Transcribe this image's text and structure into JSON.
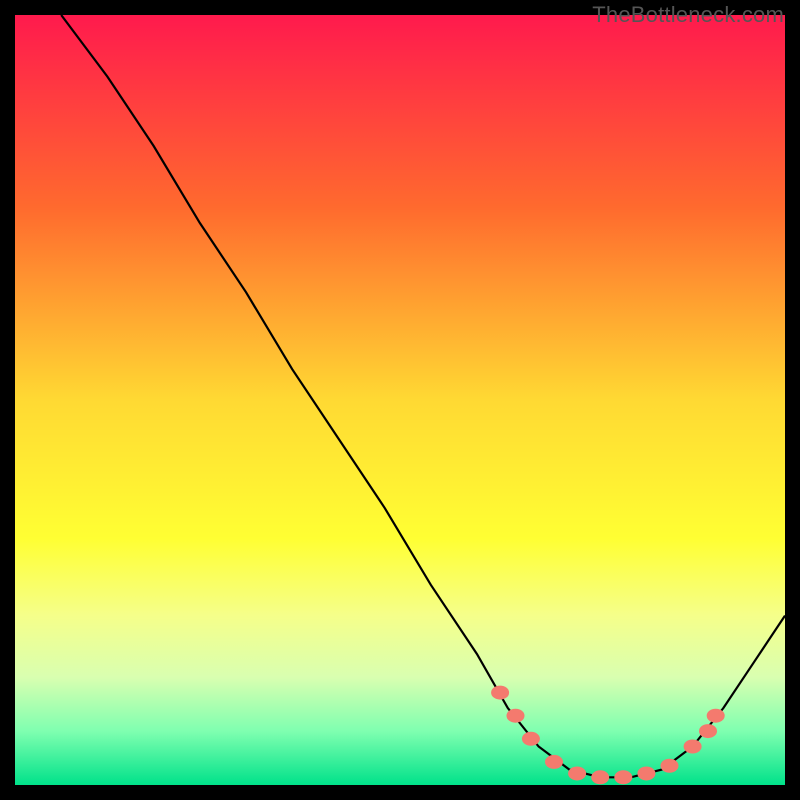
{
  "watermark": "TheBottleneck.com",
  "chart_data": {
    "type": "line",
    "title": "",
    "xlabel": "",
    "ylabel": "",
    "xlim": [
      0,
      100
    ],
    "ylim": [
      0,
      100
    ],
    "background_gradient": {
      "stops": [
        {
          "offset": 0.0,
          "color": "#ff1a4d"
        },
        {
          "offset": 0.25,
          "color": "#ff6a2e"
        },
        {
          "offset": 0.5,
          "color": "#ffd933"
        },
        {
          "offset": 0.68,
          "color": "#ffff33"
        },
        {
          "offset": 0.78,
          "color": "#f5ff8a"
        },
        {
          "offset": 0.86,
          "color": "#d9ffb0"
        },
        {
          "offset": 0.93,
          "color": "#7fffb0"
        },
        {
          "offset": 1.0,
          "color": "#00e28a"
        }
      ]
    },
    "series": [
      {
        "name": "curve",
        "color": "#000000",
        "width": 2.2,
        "points": [
          {
            "x": 6,
            "y": 100
          },
          {
            "x": 12,
            "y": 92
          },
          {
            "x": 18,
            "y": 83
          },
          {
            "x": 24,
            "y": 73
          },
          {
            "x": 30,
            "y": 64
          },
          {
            "x": 36,
            "y": 54
          },
          {
            "x": 42,
            "y": 45
          },
          {
            "x": 48,
            "y": 36
          },
          {
            "x": 54,
            "y": 26
          },
          {
            "x": 60,
            "y": 17
          },
          {
            "x": 64,
            "y": 10
          },
          {
            "x": 68,
            "y": 5
          },
          {
            "x": 72,
            "y": 2
          },
          {
            "x": 76,
            "y": 1
          },
          {
            "x": 80,
            "y": 1
          },
          {
            "x": 84,
            "y": 2
          },
          {
            "x": 88,
            "y": 5
          },
          {
            "x": 92,
            "y": 10
          },
          {
            "x": 96,
            "y": 16
          },
          {
            "x": 100,
            "y": 22
          }
        ]
      }
    ],
    "markers": [
      {
        "x": 63,
        "y": 12,
        "color": "#f47a6e"
      },
      {
        "x": 65,
        "y": 9,
        "color": "#f47a6e"
      },
      {
        "x": 67,
        "y": 6,
        "color": "#f47a6e"
      },
      {
        "x": 70,
        "y": 3,
        "color": "#f47a6e"
      },
      {
        "x": 73,
        "y": 1.5,
        "color": "#f47a6e"
      },
      {
        "x": 76,
        "y": 1,
        "color": "#f47a6e"
      },
      {
        "x": 79,
        "y": 1,
        "color": "#f47a6e"
      },
      {
        "x": 82,
        "y": 1.5,
        "color": "#f47a6e"
      },
      {
        "x": 85,
        "y": 2.5,
        "color": "#f47a6e"
      },
      {
        "x": 88,
        "y": 5,
        "color": "#f47a6e"
      },
      {
        "x": 90,
        "y": 7,
        "color": "#f47a6e"
      },
      {
        "x": 91,
        "y": 9,
        "color": "#f47a6e"
      }
    ]
  }
}
